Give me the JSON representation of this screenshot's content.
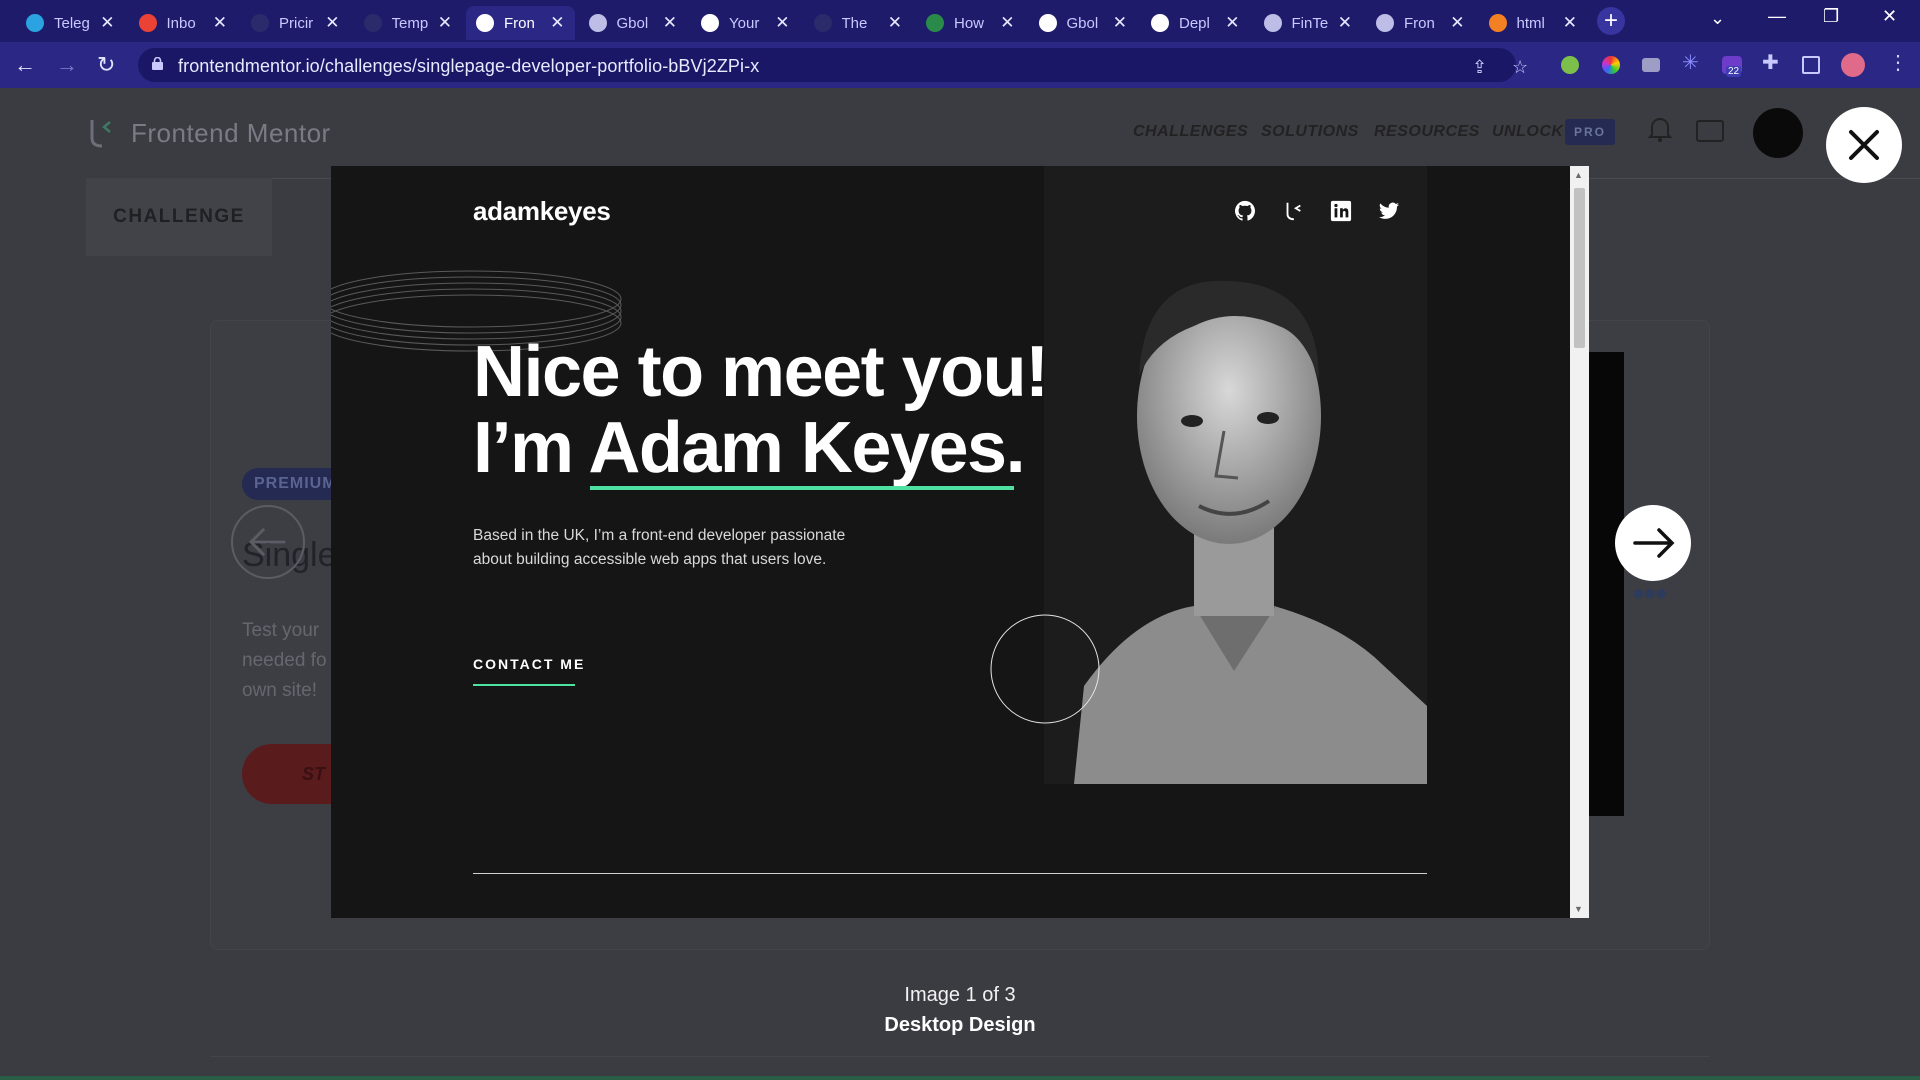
{
  "browser": {
    "tabs": [
      {
        "label": "Teleg",
        "icon": "telegram-icon",
        "color": "#2aa3e0"
      },
      {
        "label": "Inbo",
        "icon": "gmail-icon",
        "color": "#ea4335"
      },
      {
        "label": "Pricir",
        "icon": "b-icon",
        "color": "#2b2b6b"
      },
      {
        "label": "Temp",
        "icon": "b-icon",
        "color": "#2b2b6b"
      },
      {
        "label": "Fron",
        "icon": "frontend-mentor-icon",
        "color": "#ffffff"
      },
      {
        "label": "Gbol",
        "icon": "globe-icon",
        "color": "#bdbde8"
      },
      {
        "label": "Your",
        "icon": "github-icon",
        "color": "#ffffff"
      },
      {
        "label": "The",
        "icon": "b-icon",
        "color": "#2b2b6b"
      },
      {
        "label": "How",
        "icon": "infinity-icon",
        "color": "#2a8a4a"
      },
      {
        "label": "Gbol",
        "icon": "github-icon",
        "color": "#ffffff"
      },
      {
        "label": "Depl",
        "icon": "github-icon",
        "color": "#ffffff"
      },
      {
        "label": "FinTe",
        "icon": "globe-icon",
        "color": "#bdbde8"
      },
      {
        "label": "Fron",
        "icon": "globe-icon",
        "color": "#bdbde8"
      },
      {
        "label": "html",
        "icon": "stackoverflow-icon",
        "color": "#f48024"
      }
    ],
    "close_glyph": "✕",
    "url": "frontendmentor.io/challenges/singlepage-developer-portfolio-bBVj2ZPi-x",
    "extension_badge": "22"
  },
  "site": {
    "logo_text": "Frontend Mentor",
    "nav": [
      "CHALLENGES",
      "SOLUTIONS",
      "RESOURCES",
      "UNLOCK"
    ],
    "pro_badge": "PRO",
    "subtab": "CHALLENGE",
    "premium_badge": "PREMIUM",
    "challenge_title": "Single",
    "challenge_desc": "Test your needed fo own site!",
    "start_button": "ST"
  },
  "lightbox": {
    "brand": "adamkeyes",
    "headline_line1": "Nice to meet you!",
    "headline_line2_prefix": "I’m ",
    "headline_name": "Adam Keyes.",
    "bio": "Based in the UK, I’m a front-end developer passionate about building accessible web apps that users love.",
    "contact": "CONTACT ME",
    "social_icons": [
      "github-icon",
      "frontend-mentor-icon",
      "linkedin-icon",
      "twitter-icon"
    ],
    "accent": "#4ee1a0"
  },
  "caption": {
    "counter": "Image 1 of 3",
    "title": "Desktop Design"
  },
  "controls": {
    "close": "✕"
  }
}
